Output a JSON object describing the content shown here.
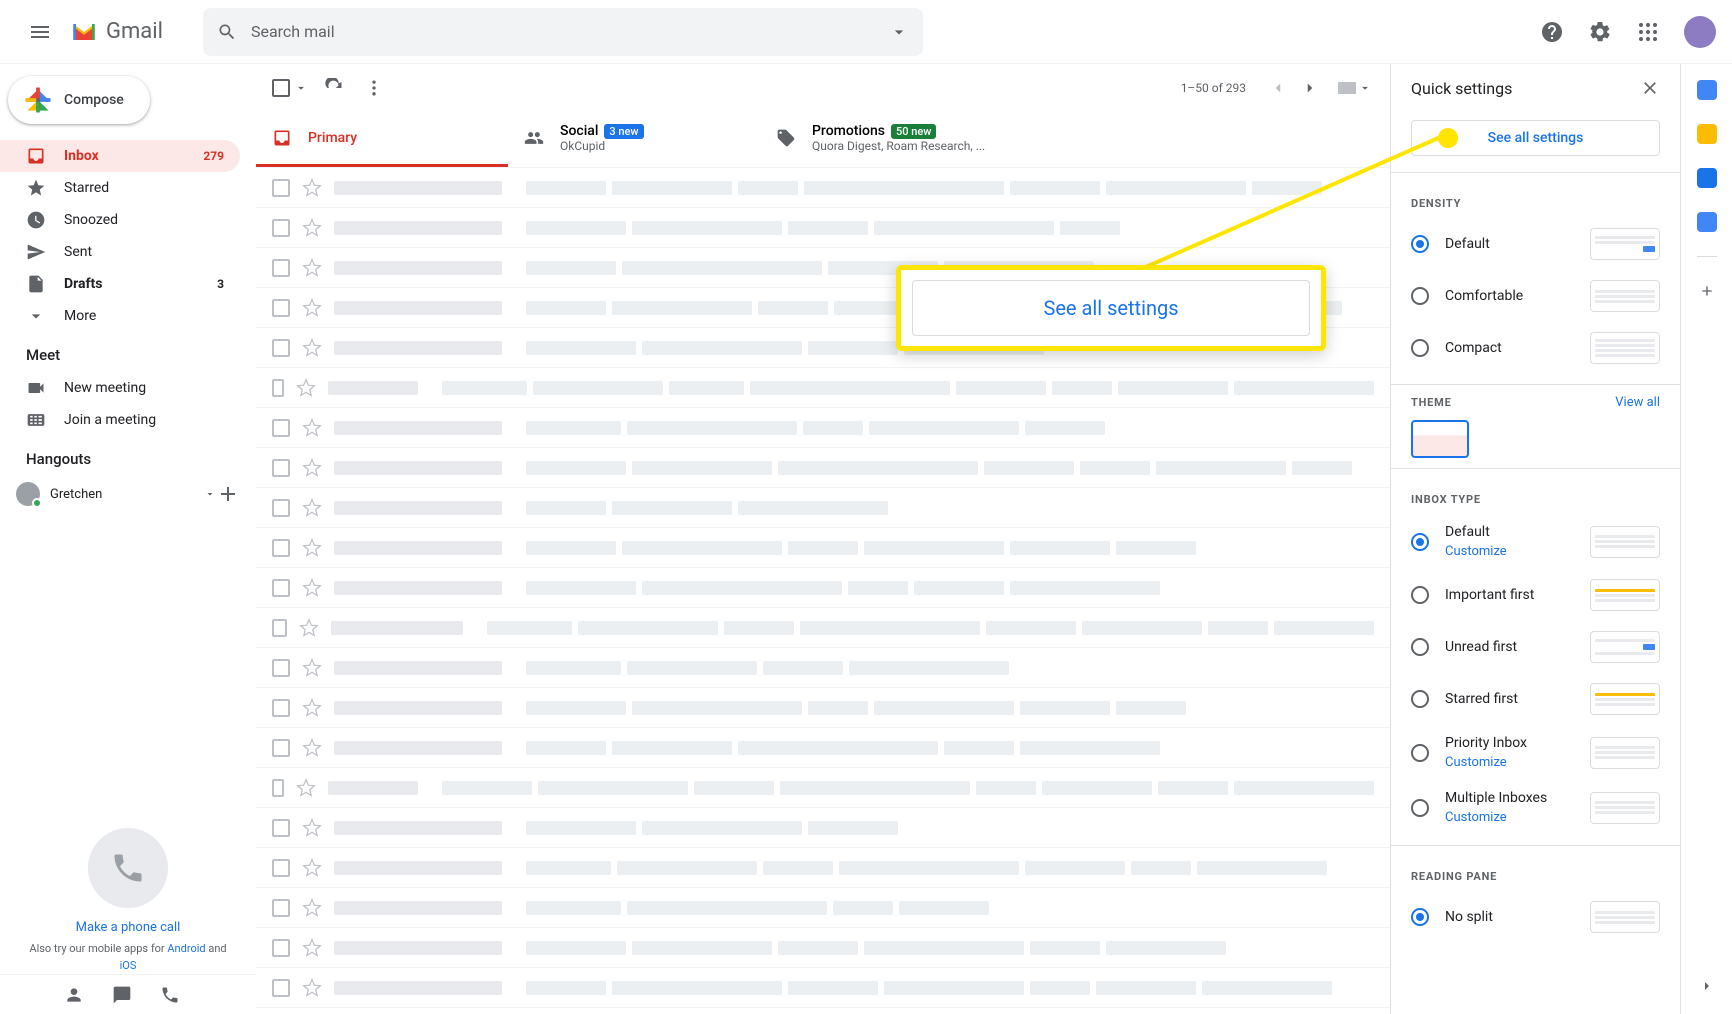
{
  "header": {
    "logo_text": "Gmail",
    "search_placeholder": "Search mail"
  },
  "compose_label": "Compose",
  "nav": {
    "inbox": {
      "label": "Inbox",
      "count": "279"
    },
    "starred": {
      "label": "Starred"
    },
    "snoozed": {
      "label": "Snoozed"
    },
    "sent": {
      "label": "Sent"
    },
    "drafts": {
      "label": "Drafts",
      "count": "3"
    },
    "more": {
      "label": "More"
    }
  },
  "meet": {
    "heading": "Meet",
    "new_meeting": "New meeting",
    "join_meeting": "Join a meeting"
  },
  "hangouts": {
    "heading": "Hangouts",
    "user": "Gretchen",
    "make_call": "Make a phone call",
    "also_try_prefix": "Also try our mobile apps for ",
    "android": "Android",
    "and": " and ",
    "ios": "iOS"
  },
  "toolbar": {
    "page_info": "1–50 of 293"
  },
  "tabs": {
    "primary": {
      "label": "Primary"
    },
    "social": {
      "label": "Social",
      "badge": "3 new",
      "sub": "OkCupid"
    },
    "promotions": {
      "label": "Promotions",
      "badge": "50 new",
      "sub": "Quora Digest, Roam Research, ..."
    }
  },
  "quick": {
    "title": "Quick settings",
    "see_all": "See all settings",
    "density_label": "Density",
    "density": {
      "default": "Default",
      "comfortable": "Comfortable",
      "compact": "Compact"
    },
    "theme_label": "Theme",
    "view_all": "View all",
    "inbox_type_label": "Inbox type",
    "inbox_type": {
      "default": "Default",
      "customize": "Customize",
      "important_first": "Important first",
      "unread_first": "Unread first",
      "starred_first": "Starred first",
      "priority_inbox": "Priority Inbox",
      "multiple_inboxes": "Multiple Inboxes"
    },
    "reading_pane_label": "Reading pane",
    "reading_pane": {
      "no_split": "No split"
    }
  },
  "callout": {
    "text": "See all settings"
  }
}
